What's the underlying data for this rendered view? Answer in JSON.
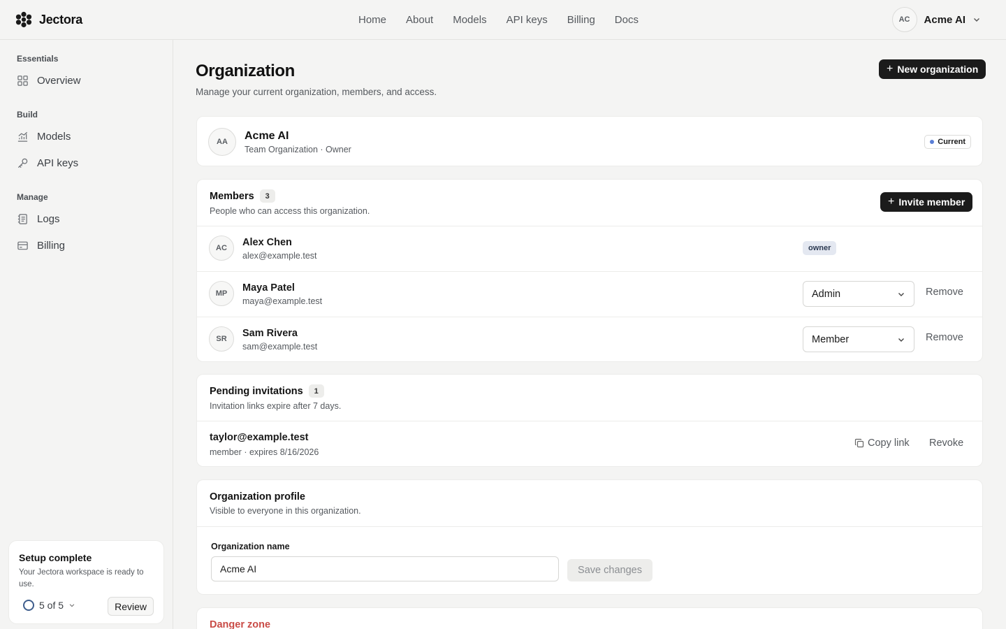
{
  "brand": {
    "name": "Jectora"
  },
  "topnav": [
    "Home",
    "About",
    "Models",
    "API keys",
    "Billing",
    "Docs"
  ],
  "account": {
    "initials": "AC",
    "name": "Acme AI"
  },
  "sidebar": {
    "groups": [
      {
        "title": "Essentials",
        "items": [
          {
            "label": "Overview",
            "icon": "grid-icon"
          }
        ]
      },
      {
        "title": "Build",
        "items": [
          {
            "label": "Models",
            "icon": "chart-icon"
          },
          {
            "label": "API keys",
            "icon": "key-icon"
          }
        ]
      },
      {
        "title": "Manage",
        "items": [
          {
            "label": "Logs",
            "icon": "logs-icon"
          },
          {
            "label": "Billing",
            "icon": "card-icon"
          }
        ]
      }
    ],
    "setup": {
      "title": "Setup complete",
      "description": "Your Jectora workspace is ready to use.",
      "progress": "5 of 5",
      "review_label": "Review"
    }
  },
  "page": {
    "title": "Organization",
    "subtitle": "Manage your current organization, members, and access.",
    "new_org_label": "New organization"
  },
  "org": {
    "initials": "AA",
    "name": "Acme AI",
    "meta": "Team Organization · Owner",
    "badge": "Current"
  },
  "members": {
    "title": "Members",
    "count": "3",
    "subtitle": "People who can access this organization.",
    "invite_label": "Invite member",
    "remove_label": "Remove",
    "rows": [
      {
        "initials": "AC",
        "name": "Alex Chen",
        "email": "alex@example.test",
        "role": "owner"
      },
      {
        "initials": "MP",
        "name": "Maya Patel",
        "email": "maya@example.test",
        "role": "Admin"
      },
      {
        "initials": "SR",
        "name": "Sam Rivera",
        "email": "sam@example.test",
        "role": "Member"
      }
    ]
  },
  "invitations": {
    "title": "Pending invitations",
    "count": "1",
    "subtitle": "Invitation links expire after 7 days.",
    "item": {
      "email": "taylor@example.test",
      "meta": "member · expires 8/16/2026"
    },
    "copy_label": "Copy link",
    "revoke_label": "Revoke"
  },
  "profile": {
    "title": "Organization profile",
    "subtitle": "Visible to everyone in this organization.",
    "field_label": "Organization name",
    "field_value": "Acme AI",
    "save_label": "Save changes"
  },
  "danger": {
    "title": "Danger zone"
  },
  "colors": {
    "accent": "#1b1b1b",
    "danger": "#c94b46",
    "current_dot": "#5b7fd6"
  }
}
